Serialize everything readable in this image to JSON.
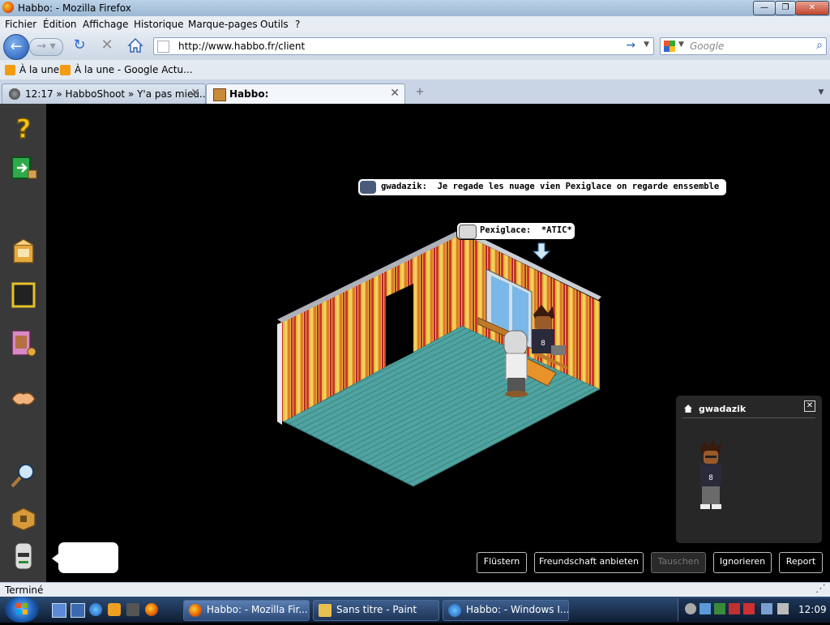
{
  "window": {
    "title": "Habbo: - Mozilla Firefox"
  },
  "menu": [
    "Fichier",
    "Édition",
    "Affichage",
    "Historique",
    "Marque-pages",
    "Outils",
    "?"
  ],
  "nav": {
    "url": "http://www.habbo.fr/client",
    "search_placeholder": "Google"
  },
  "bookmarks": [
    "À la une",
    "À la une - Google Actu..."
  ],
  "tabs": [
    {
      "label": "12:17 » HabboShoot » Y'a pas mieu...",
      "active": false
    },
    {
      "label": "Habbo:",
      "active": true
    }
  ],
  "chat": [
    {
      "user": "gwadazik:",
      "message": "Je regade les nuage vien Pexiglace on regarde enssemble :)"
    },
    {
      "user": "Pexiglace:",
      "message": "*ATIC*"
    }
  ],
  "info_panel": {
    "name": "gwadazik"
  },
  "actions": [
    "Flüstern",
    "Freundschaft anbieten",
    "Tauschen",
    "Ignorieren",
    "Report"
  ],
  "status": "Terminé",
  "taskbar": {
    "tasks": [
      "Habbo: - Mozilla Fir...",
      "Sans titre - Paint",
      "Habbo: - Windows I..."
    ],
    "clock": "12:09"
  },
  "colors": {
    "client_bg": "#000000",
    "sidebar": "#393939",
    "floor": "#4fa3a0",
    "panel": "#272727"
  }
}
